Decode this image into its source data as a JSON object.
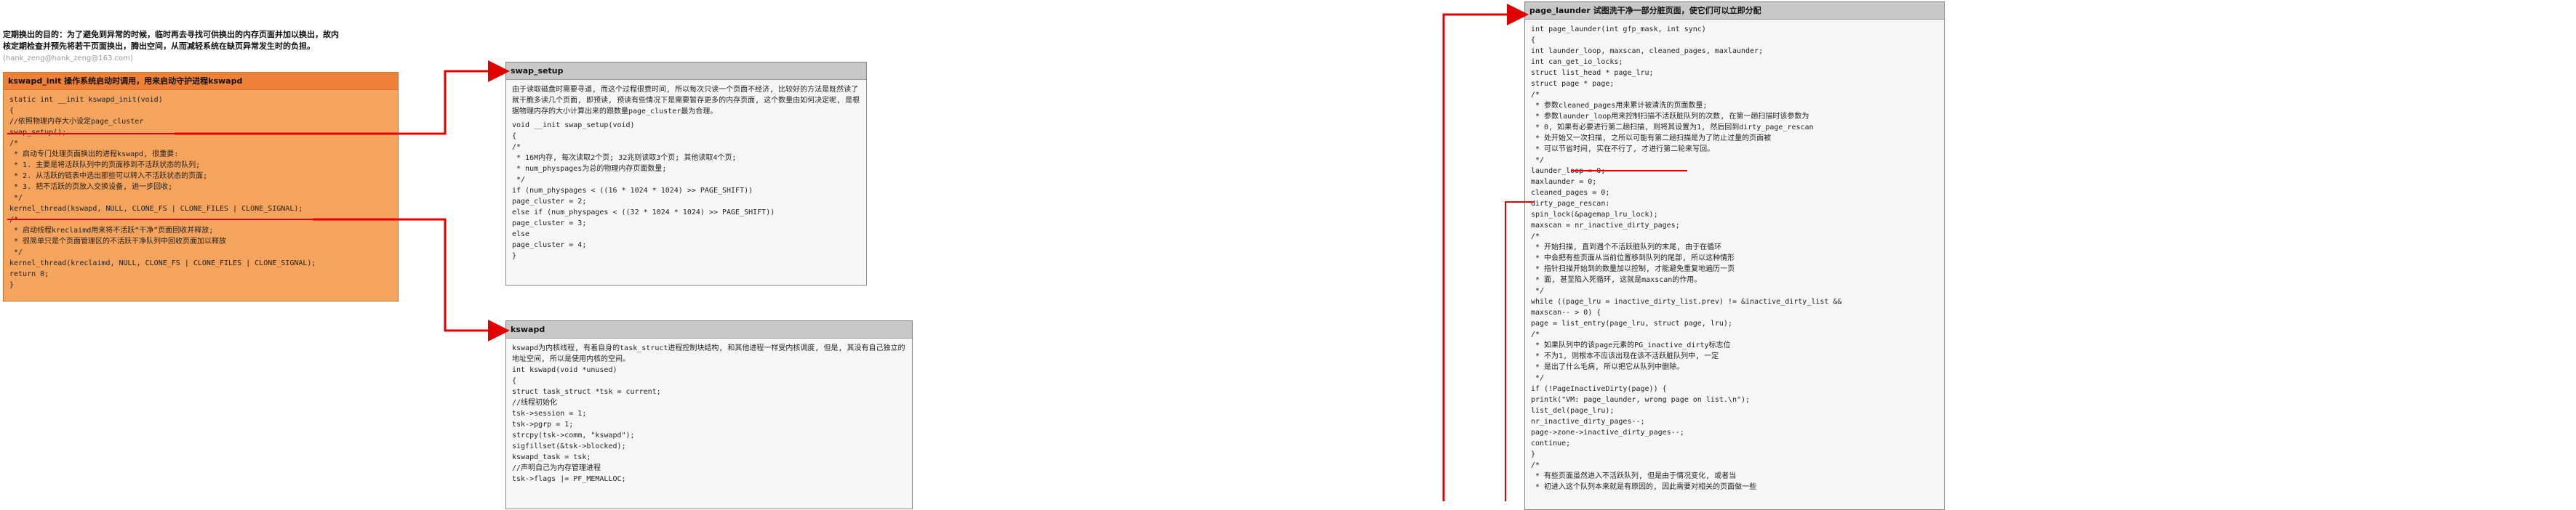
{
  "intro": {
    "text": "定期换出的目的：为了避免到异常的时候，临时再去寻找可供换出的内存页面并加以换出，故内核定期检查并预先将若干页面换出，腾出空间，从而减轻系统在缺页异常发生时的负担。",
    "author": "(hank_zeng@hank_zeng@163.com)"
  },
  "kswapd_init": {
    "title": "kswapd_init 操作系统启动时调用，用来启动守护进程kswapd",
    "code": "static int __init kswapd_init(void)\n{\n//依照物理内存大小设定page_cluster\nswap_setup();\n/*\n * 启动专门处理页面换出的进程kswapd, 很重要:\n * 1. 主要是将活跃队列中的页面移到不活跃状态的队列;\n * 2. 从活跃的链表中选出那些可以转入不活跃状态的页面;\n * 3. 把不活跃的页放入交换设备, 进一步回收;\n */\nkernel_thread(kswapd, NULL, CLONE_FS | CLONE_FILES | CLONE_SIGNAL);\n/*\n * 启动线程kreclaimd用来将不活跃“干净”页面回收并释放;\n * 很简单只是个页面管理区的不活跃干净队列中回收页面加以释放\n */\nkernel_thread(kreclaimd, NULL, CLONE_FS | CLONE_FILES | CLONE_SIGNAL);\nreturn 0;\n}"
  },
  "swap_setup": {
    "title": "swap_setup",
    "desc": "由于读取磁盘时需要寻道, 而这个过程很费时间, 所以每次只读一个页面不经济, 比较好的方法是既然读了就干脆多读几个页面, 即预读, 预读有些情况下是需要暂存更多的内存页面, 这个数量由如何决定呢, 是根据物理内存的大小计算出来的跟数量page_cluster最为合理。",
    "code": "void __init swap_setup(void)\n{\n/*\n * 16M内存, 每次读取2个页; 32兆则读取3个页; 其他读取4个页;\n * num_physpages为总的物理内存页面数量;\n */\nif (num_physpages < ((16 * 1024 * 1024) >> PAGE_SHIFT))\npage_cluster = 2;\nelse if (num_physpages < ((32 * 1024 * 1024) >> PAGE_SHIFT))\npage_cluster = 3;\nelse\npage_cluster = 4;\n}"
  },
  "kswapd": {
    "title": "kswapd",
    "desc": "kswapd为内核线程, 有着自身的task_struct进程控制块结构, 和其他进程一样受内核调度, 但是, 其没有自己独立的地址空间, 所以是使用内核的空间。",
    "code": "int kswapd(void *unused)\n{\nstruct task_struct *tsk = current;\n//线程初始化\ntsk->session = 1;\ntsk->pgrp = 1;\nstrcpy(tsk->comm, \"kswapd\");\nsigfillset(&tsk->blocked);\nkswapd_task = tsk;\n//声明自己为内存管理进程\ntsk->flags |= PF_MEMALLOC;"
  },
  "page_launder": {
    "title": "page_launder 试图洗干净一部分脏页面，使它们可以立即分配",
    "code": "int page_launder(int gfp_mask, int sync)\n{\nint launder_loop, maxscan, cleaned_pages, maxlaunder;\nint can_get_io_locks;\nstruct list_head * page_lru;\nstruct page * page;\n/*\n * 参数cleaned_pages用来累计被清洗的页面数量;\n * 参数launder_loop用来控制扫描不活跃脏队列的次数, 在第一趟扫描时该参数为\n * 0, 如果有必要进行第二趟扫描, 则将其设置为1, 然后回到dirty_page_rescan\n * 处开始又一次扫描, 之所以可能有第二趟扫描是为了防止过量的页面被\n * 可以节省时间, 实在不行了, 才进行第二轮来写回。\n */\nlaunder_loop = 0;\nmaxlaunder = 0;\ncleaned_pages = 0;\ndirty_page_rescan:\nspin_lock(&pagemap_lru_lock);\nmaxscan = nr_inactive_dirty_pages;\n/*\n * 开始扫描, 直到遇个不活跃脏队列的末尾, 由于在循环\n * 中会把有些页面从当前位置移到队列的尾部, 所以这种情形\n * 指针扫描开始到的数量加以控制, 才能避免重复地遍历一页\n * 面, 甚至陷入死循环, 这就是maxscan的作用。\n */\nwhile ((page_lru = inactive_dirty_list.prev) != &inactive_dirty_list &&\nmaxscan-- > 0) {\npage = list_entry(page_lru, struct page, lru);\n/*\n * 如果队列中的该page元素的PG_inactive_dirty标志位\n * 不为1, 则根本不应该出现在该不活跃脏队列中, 一定\n * 是出了什么毛病, 所以把它从队列中删除。\n */\nif (!PageInactiveDirty(page)) {\nprintk(\"VM: page_launder, wrong page on list.\\n\");\nlist_del(page_lru);\nnr_inactive_dirty_pages--;\npage->zone->inactive_dirty_pages--;\ncontinue;\n}\n/*\n * 有些页面虽然进入不活跃队列, 但是由于情况变化, 或者当\n * 初进入这个队列本来就是有原因的, 因此需要对相关的页面做一些"
  }
}
